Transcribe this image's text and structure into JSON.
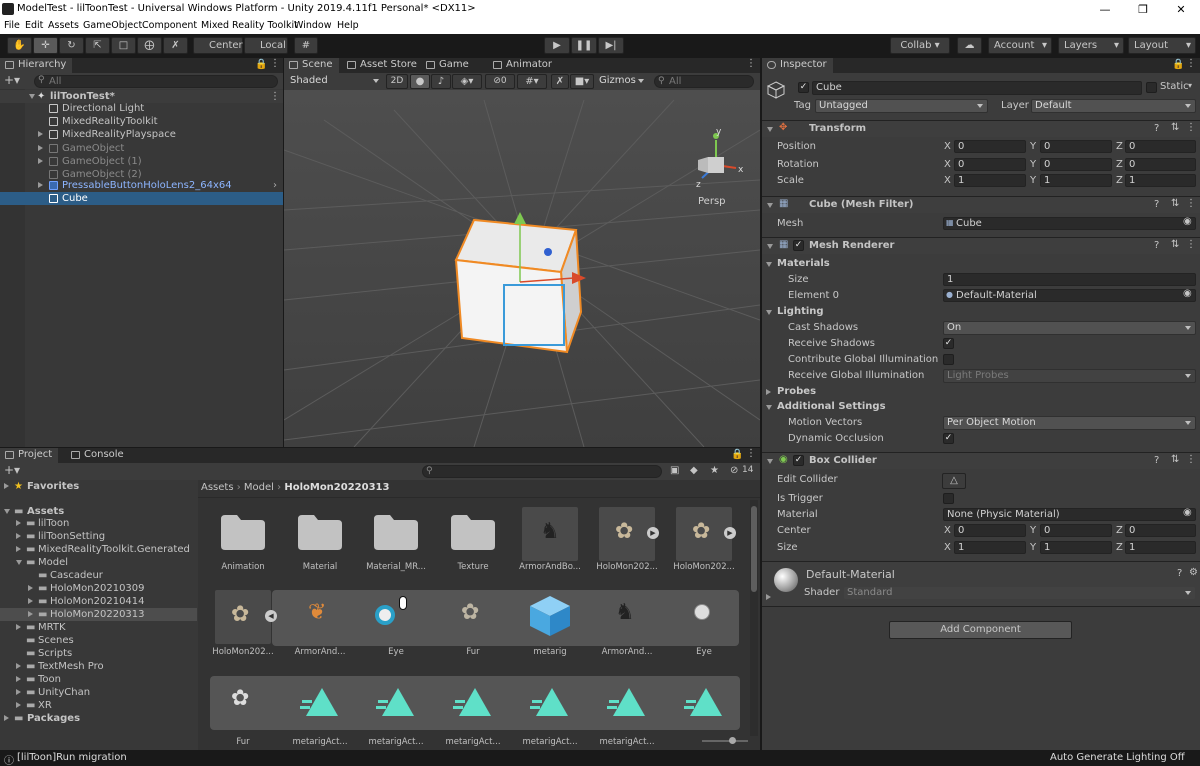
{
  "window": {
    "title": "ModelTest - lilToonTest - Universal Windows Platform - Unity 2019.4.11f1 Personal* <DX11>",
    "controls": [
      "—",
      "❐",
      "✕"
    ]
  },
  "menu": [
    "File",
    "Edit",
    "Assets",
    "GameObject",
    "Component",
    "Mixed Reality Toolkit",
    "Window",
    "Help"
  ],
  "toolbar": {
    "pivot_center": "Center",
    "pivot_local": "Local",
    "collab": "Collab ▾",
    "account": "Account",
    "layers": "Layers",
    "layout": "Layout"
  },
  "hierarchy": {
    "tab": "Hierarchy",
    "search_placeholder": "All",
    "scene": "lilToonTest*",
    "items": [
      {
        "label": "Directional Light"
      },
      {
        "label": "MixedRealityToolkit"
      },
      {
        "label": "MixedRealityPlayspace"
      },
      {
        "label": "GameObject"
      },
      {
        "label": "GameObject (1)"
      },
      {
        "label": "GameObject (2)"
      },
      {
        "label": "PressableButtonHoloLens2_64x64"
      },
      {
        "label": "Cube"
      }
    ]
  },
  "scene_view": {
    "tabs": [
      "Scene",
      "Asset Store",
      "Game",
      "Animator"
    ],
    "shading": "Shaded",
    "mode_2d": "2D",
    "hidden_count": "0",
    "gizmos": "Gizmos",
    "search_placeholder": "All",
    "persp": "Persp",
    "gizmo_axes": {
      "x": "x",
      "y": "y",
      "z": "z"
    }
  },
  "project": {
    "tabs": [
      "Project",
      "Console"
    ],
    "count": "14",
    "breadcrumb": [
      "Assets",
      "Model",
      "HoloMon20220313"
    ],
    "tree": [
      {
        "label": "Favorites"
      },
      {
        "label": "Assets"
      },
      {
        "label": "lilToon"
      },
      {
        "label": "lilToonSetting"
      },
      {
        "label": "MixedRealityToolkit.Generated"
      },
      {
        "label": "Model"
      },
      {
        "label": "Cascadeur"
      },
      {
        "label": "HoloMon20210309"
      },
      {
        "label": "HoloMon20210414"
      },
      {
        "label": "HoloMon20220313"
      },
      {
        "label": "MRTK"
      },
      {
        "label": "Scenes"
      },
      {
        "label": "Scripts"
      },
      {
        "label": "TextMesh Pro"
      },
      {
        "label": "Toon"
      },
      {
        "label": "UnityChan"
      },
      {
        "label": "XR"
      },
      {
        "label": "Packages"
      }
    ],
    "row1": [
      "Animation",
      "Material",
      "Material_MR...",
      "Texture",
      "ArmorAndBo...",
      "HoloMon202...",
      "HoloMon202..."
    ],
    "row2": [
      "HoloMon202...",
      "ArmorAnd...",
      "Eye",
      "Fur",
      "metarig",
      "ArmorAnd...",
      "Eye"
    ],
    "row3": [
      "Fur",
      "metarigAct...",
      "metarigAct...",
      "metarigAct...",
      "metarigAct...",
      "metarigAct..."
    ]
  },
  "inspector": {
    "tab": "Inspector",
    "object_name": "Cube",
    "static": "Static",
    "tag_label": "Tag",
    "tag": "Untagged",
    "layer_label": "Layer",
    "layer": "Default",
    "transform": {
      "title": "Transform",
      "position": {
        "label": "Position",
        "x": "0",
        "y": "0",
        "z": "0"
      },
      "rotation": {
        "label": "Rotation",
        "x": "0",
        "y": "0",
        "z": "0"
      },
      "scale": {
        "label": "Scale",
        "x": "1",
        "y": "1",
        "z": "1"
      },
      "axes": [
        "X",
        "Y",
        "Z"
      ]
    },
    "mesh_filter": {
      "title": "Cube (Mesh Filter)",
      "mesh_label": "Mesh",
      "mesh": "Cube"
    },
    "mesh_renderer": {
      "title": "Mesh Renderer",
      "materials": "Materials",
      "size_label": "Size",
      "size": "1",
      "element0_label": "Element 0",
      "element0": "Default-Material",
      "lighting": "Lighting",
      "cast_shadows_label": "Cast Shadows",
      "cast_shadows": "On",
      "receive_shadows_label": "Receive Shadows",
      "contribute_gi_label": "Contribute Global Illumination",
      "receive_gi_label": "Receive Global Illumination",
      "receive_gi": "Light Probes",
      "probes": "Probes",
      "additional": "Additional Settings",
      "motion_vectors_label": "Motion Vectors",
      "motion_vectors": "Per Object Motion",
      "dynamic_occlusion_label": "Dynamic Occlusion"
    },
    "box_collider": {
      "title": "Box Collider",
      "edit_collider": "Edit Collider",
      "is_trigger": "Is Trigger",
      "material_label": "Material",
      "material": "None (Physic Material)",
      "center_label": "Center",
      "center": {
        "x": "0",
        "y": "0",
        "z": "0"
      },
      "size_label": "Size",
      "size": {
        "x": "1",
        "y": "1",
        "z": "1"
      }
    },
    "material": {
      "name": "Default-Material",
      "shader_label": "Shader",
      "shader": "Standard"
    },
    "add_component": "Add Component"
  },
  "statusbar": {
    "message": "[lilToon]Run migration",
    "right": "Auto Generate Lighting Off"
  },
  "colors": {
    "accent": "#2c5d87",
    "selection": "#2c5d87",
    "link": "#8db5ff",
    "cube_outline": "#f08a24"
  }
}
